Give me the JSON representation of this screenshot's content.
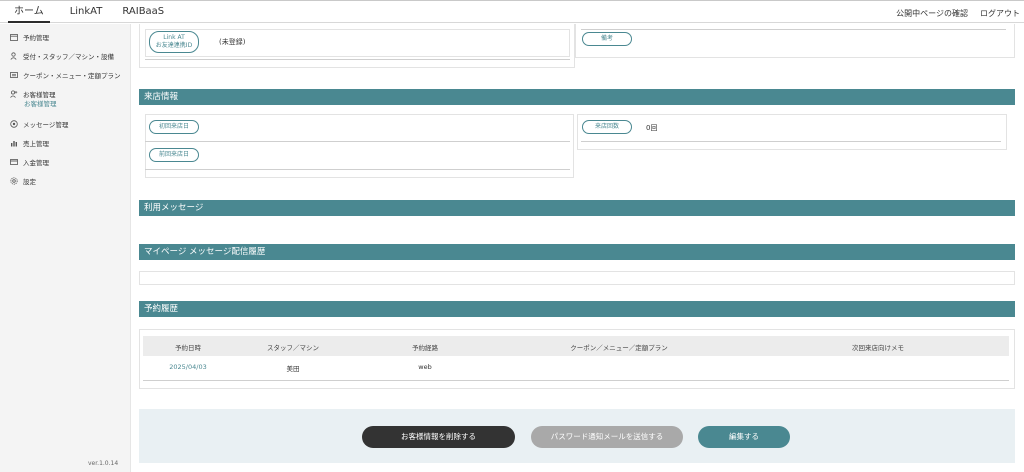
{
  "topbar": {
    "tabs": [
      {
        "label": "ホーム"
      },
      {
        "label": "LinkAT"
      },
      {
        "label": "RAIBaaS"
      }
    ],
    "public_page_check": "公開中ページの確認",
    "logout": "ログアウト"
  },
  "sidebar": {
    "items": [
      {
        "label": "予約管理",
        "icon": "calendar-icon"
      },
      {
        "label": "受付・スタッフ／マシン・設備",
        "icon": "staff-icon"
      },
      {
        "label": "クーポン・メニュー・定額プラン",
        "icon": "coupon-icon"
      },
      {
        "label": "お客様管理",
        "icon": "customer-icon"
      },
      {
        "label": "メッセージ管理",
        "icon": "message-icon"
      },
      {
        "label": "売上管理",
        "icon": "chart-icon"
      },
      {
        "label": "入金管理",
        "icon": "payment-icon"
      },
      {
        "label": "設定",
        "icon": "gear-icon"
      }
    ],
    "sub_item": "お客様管理",
    "version": "ver.1.0.14"
  },
  "customer": {
    "link_id_label_line1": "Link AT",
    "link_id_label_line2": "お友達連携ID",
    "link_id_value": "(未登録)",
    "note_label": "備考"
  },
  "visit_info": {
    "title": "来店情報",
    "first_visit_label": "初回来店日",
    "last_visit_label": "前回来店日",
    "visit_count_label": "来店回数",
    "visit_count_value": "0回"
  },
  "usage_message": {
    "title": "利用メッセージ"
  },
  "mypage_history": {
    "title": "マイページ メッセージ配信履歴"
  },
  "reservations": {
    "title": "予約履歴",
    "columns": [
      "予約日時",
      "スタッフ／マシン",
      "予約経路",
      "クーポン／メニュー／定額プラン",
      "次回来店向けメモ"
    ],
    "rows": [
      {
        "date": "2025/04/03",
        "staff": "美田",
        "route": "web",
        "coupon": "",
        "memo": ""
      }
    ]
  },
  "actions": {
    "delete": "お客様情報を削除する",
    "send_password": "パスワード通知メールを送信する",
    "edit": "編集する"
  },
  "colors": {
    "accent": "#4a8891",
    "dark_button": "#333333",
    "disabled_button": "#a9a9a9",
    "footer_bg": "#e9f0f3"
  }
}
